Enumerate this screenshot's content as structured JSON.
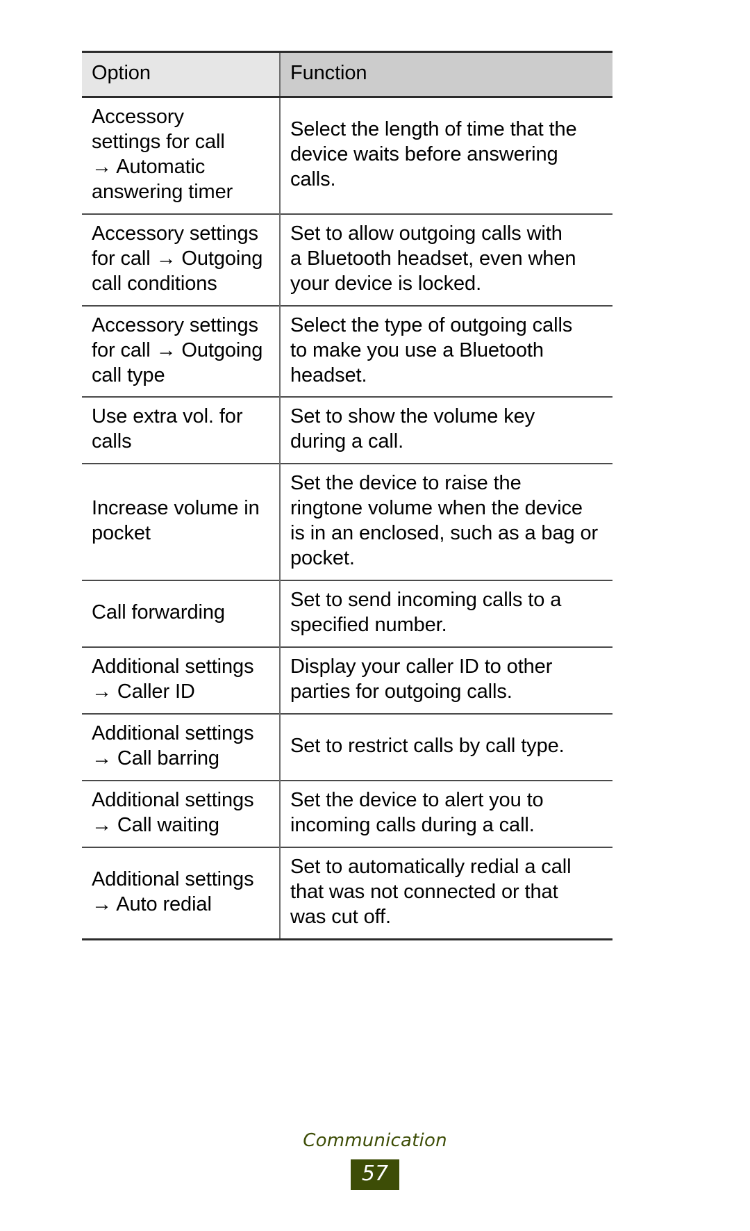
{
  "table": {
    "columns": [
      "Option",
      "Function"
    ],
    "rows": [
      {
        "option": "Accessory\nsettings for call\n→ Automatic\nanswering timer",
        "function": "Select the length of time that the\ndevice waits before answering\ncalls."
      },
      {
        "option": "Accessory settings\nfor call → Outgoing\ncall conditions",
        "function": "Set to allow outgoing calls with\na Bluetooth headset, even when\nyour device is locked."
      },
      {
        "option": "Accessory settings\nfor call → Outgoing\ncall type",
        "function": "Select the type of outgoing calls\nto make you use a Bluetooth\nheadset."
      },
      {
        "option": "Use extra vol. for\ncalls",
        "function": "Set to show the volume key\nduring a call."
      },
      {
        "option": "Increase volume in\npocket",
        "function": "Set the device to raise the\nringtone volume when the device\nis in an enclosed, such as a bag or\npocket."
      },
      {
        "option": "Call forwarding",
        "function": "Set to send incoming calls to a\nspecified number."
      },
      {
        "option": "Additional settings\n→ Caller ID",
        "function": "Display your caller ID to other\nparties for outgoing calls."
      },
      {
        "option": "Additional settings\n→ Call barring",
        "function": "Set to restrict calls by call type."
      },
      {
        "option": "Additional settings\n→ Call waiting",
        "function": "Set the device to alert you to\nincoming calls during a call."
      },
      {
        "option": "Additional settings\n→ Auto redial",
        "function": "Set to automatically redial a call\nthat was not connected or that\nwas cut off."
      }
    ]
  },
  "footer": {
    "chapter": "Communication",
    "page_number": "57",
    "accent_color": "#3d4d06"
  }
}
